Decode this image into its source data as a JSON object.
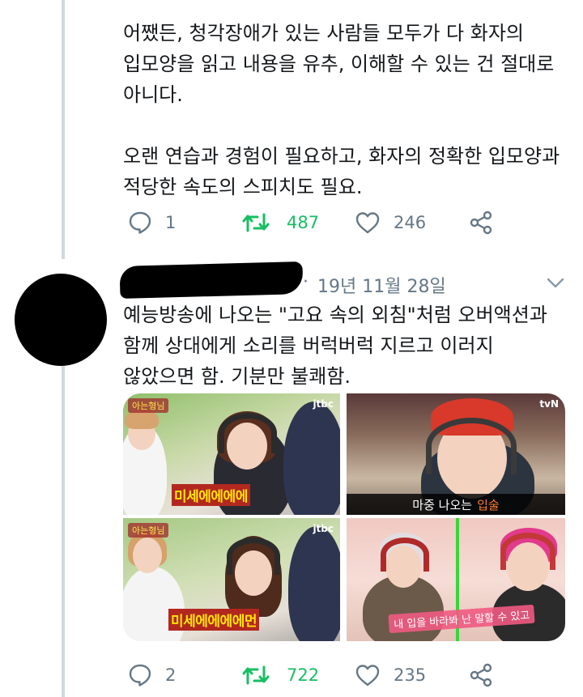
{
  "tweet1": {
    "text": "어쨌든, 청각장애가 있는 사람들 모두가 다 화자의\n입모양을 읽고 내용을 유추, 이해할 수 있는 건 절대로\n아니다.\n\n오랜 연습과 경험이 필요하고, 화자의 정확한 입모양과\n적당한 속도의 스피치도 필요.",
    "replies": "1",
    "retweets": "487",
    "likes": "246"
  },
  "tweet2": {
    "date": "19년 11월 28일",
    "separator": "·",
    "text": "예능방송에 나오는 \"고요 속의 외침\"처럼 오버액션과\n함께 상대에게 소리를 버럭버럭 지르고 이러지\n않았으면 함. 기분만 불쾌함.",
    "replies": "2",
    "retweets": "722",
    "likes": "235",
    "media": {
      "tile_a_caption": "미세에에에에",
      "tile_b_caption": "미세에에에에먼",
      "tile_c_caption_prefix": "마중 나오는",
      "tile_c_caption_highlight": "입술",
      "tile_d_caption": "내 입을 바라봐 난 말할 수 있고",
      "logo_jtbc": "jtbc",
      "logo_tvn": "tvN"
    }
  },
  "colors": {
    "retweet_green": "#17bf63",
    "icon_gray": "#657786",
    "thread_line": "#cfd9de"
  },
  "icons": [
    "reply-icon",
    "retweet-icon",
    "like-icon",
    "share-icon",
    "chevron-down-icon"
  ]
}
